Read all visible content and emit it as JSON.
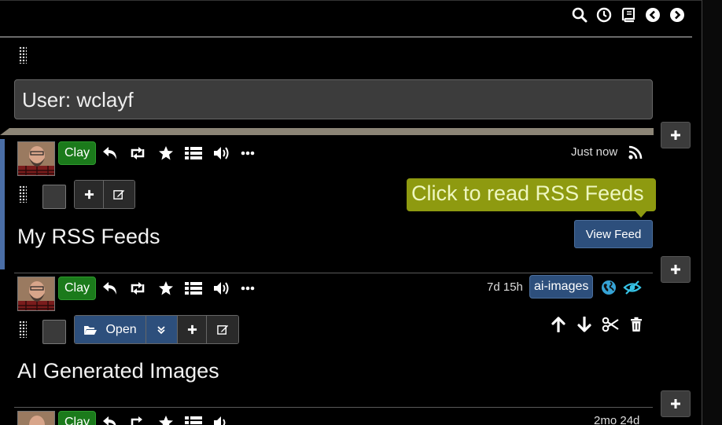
{
  "header": {
    "icons": [
      "search-icon",
      "clock-icon",
      "book-icon",
      "chevron-left-circle-icon",
      "chevron-right-circle-icon"
    ]
  },
  "user_input": {
    "value": "User: wclayf"
  },
  "colors": {
    "accent_blue": "#2d4f7c",
    "clay_green": "#1b7a1b",
    "tooltip_olive": "#8e9a10",
    "left_accent": "#4a6ea6"
  },
  "cards": [
    {
      "user_label": "Clay",
      "time": "Just now",
      "title": "My RSS Feeds",
      "tooltip": "Click to read RSS Feeds",
      "view_feed_label": "View Feed"
    },
    {
      "user_label": "Clay",
      "time": "7d 15h",
      "tag": "ai-images",
      "open_label": "Open",
      "title": "AI Generated Images"
    },
    {
      "user_label": "Clay",
      "time": "2mo 24d"
    }
  ]
}
